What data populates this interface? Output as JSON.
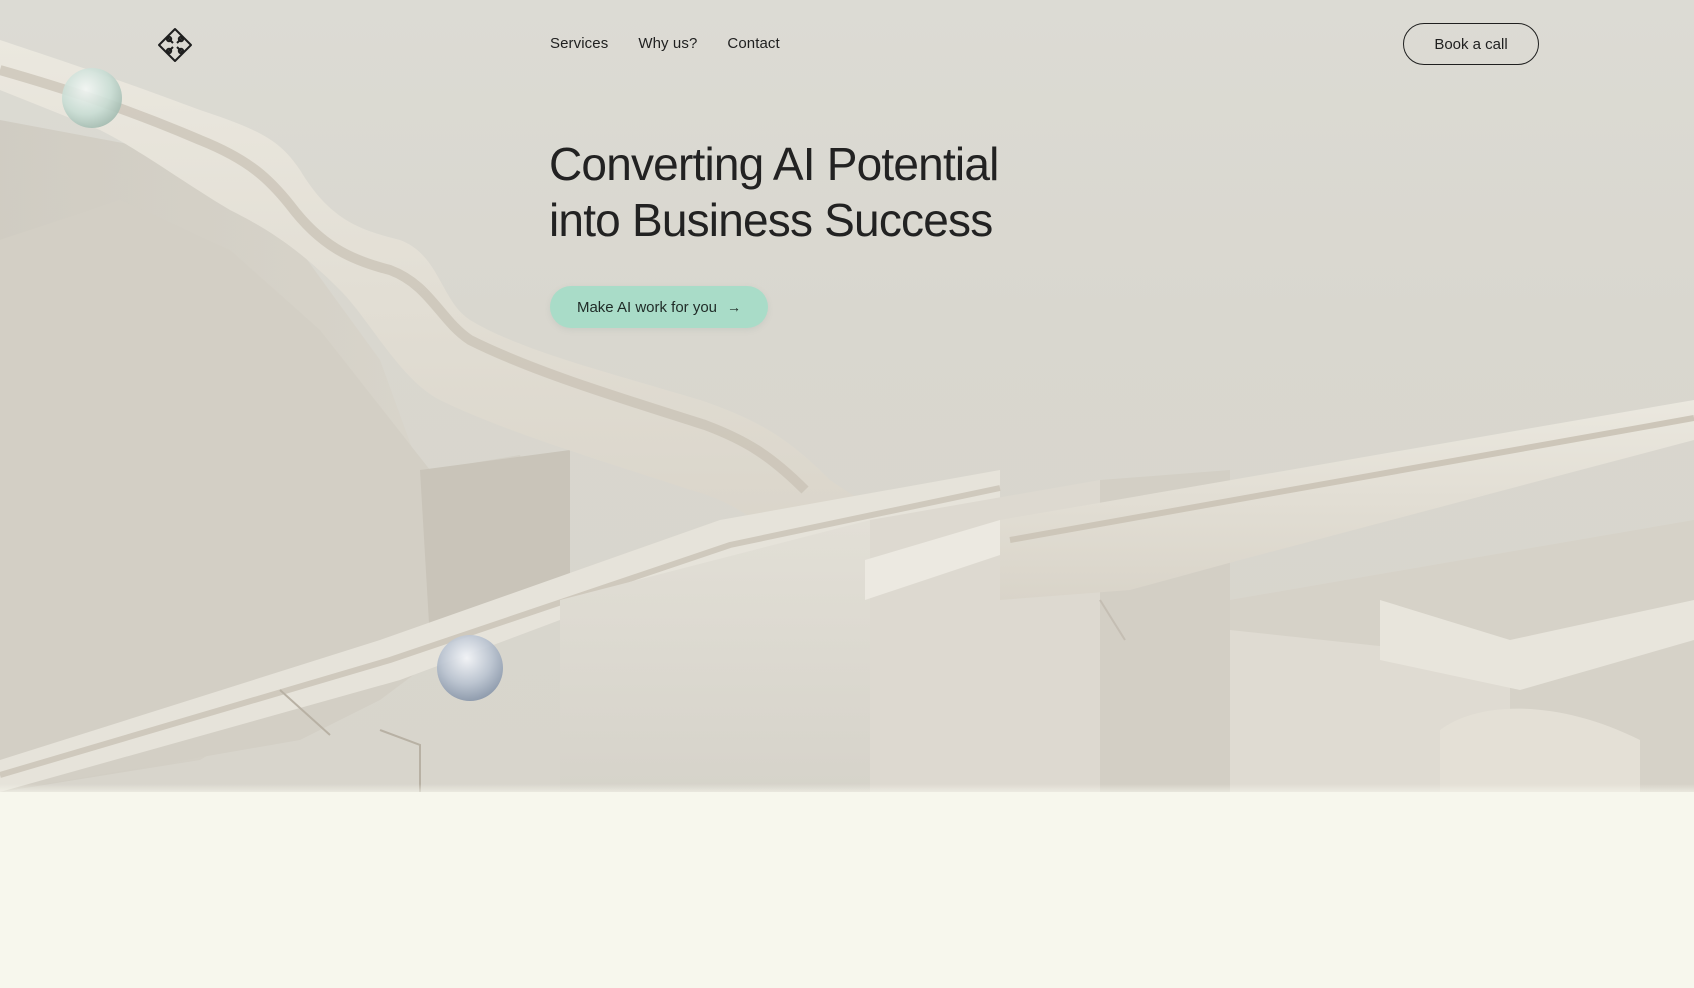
{
  "header": {
    "logo_icon": "diamond-chain-logo",
    "nav": [
      {
        "label": "Services"
      },
      {
        "label": "Why us?"
      },
      {
        "label": "Contact"
      }
    ],
    "cta_label": "Book a call"
  },
  "hero": {
    "headline_line1": "Converting AI Potential",
    "headline_line2": "into Business Success",
    "cta_label": "Make AI work for you",
    "cta_icon": "arrow-right-icon",
    "background_image": "marble-run-3d-illustration",
    "colors": {
      "cta_background": "#a9dcc8",
      "hero_background": "#dad8d0",
      "page_background": "#f7f7ed",
      "text": "#222222"
    }
  }
}
